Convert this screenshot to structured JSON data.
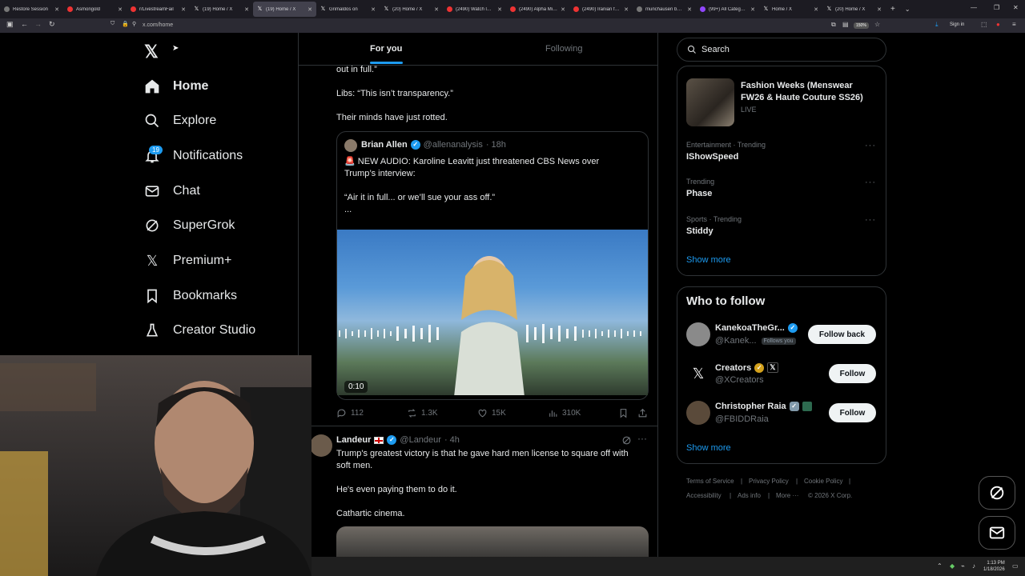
{
  "browser": {
    "tabs": [
      {
        "title": "Restore Session",
        "active": false
      },
      {
        "title": "Asmongold",
        "active": false
      },
      {
        "title": "r/LivestreamFail",
        "active": false
      },
      {
        "title": "(19) Home / X",
        "active": false
      },
      {
        "title": "(19) Home / X",
        "active": true
      },
      {
        "title": "Grimaldos on",
        "active": false
      },
      {
        "title": "(20) Home / X",
        "active": false
      },
      {
        "title": "(2490) Watch later",
        "active": false
      },
      {
        "title": "(2490) Alpha Mike",
        "active": false
      },
      {
        "title": "(2490) Iranian forc",
        "active": false
      },
      {
        "title": "munchausen by pr",
        "active": false
      },
      {
        "title": "(99+) All Categorie",
        "active": false
      },
      {
        "title": "Home / X",
        "active": false
      },
      {
        "title": "(20) Home / X",
        "active": false
      }
    ],
    "url": "x.com/home",
    "zoom": "150%",
    "sign_in": "Sign in"
  },
  "nav": {
    "items": [
      {
        "label": "Home",
        "icon": "home-icon"
      },
      {
        "label": "Explore",
        "icon": "search-icon"
      },
      {
        "label": "Notifications",
        "icon": "bell-icon"
      },
      {
        "label": "Chat",
        "icon": "mail-icon"
      },
      {
        "label": "SuperGrok",
        "icon": "grok-icon"
      },
      {
        "label": "Premium+",
        "icon": "x-logo-icon"
      },
      {
        "label": "Bookmarks",
        "icon": "bookmark-icon"
      },
      {
        "label": "Creator Studio",
        "icon": "creator-icon"
      }
    ],
    "notifications_badge": "19"
  },
  "feed": {
    "tabs": [
      "For you",
      "Following"
    ],
    "post1": {
      "lines": [
        "out in full.”",
        "Libs: “This isn’t transparency.”",
        "Their minds have just rotted."
      ]
    },
    "quote": {
      "name": "Brian Allen",
      "handle": "@allenanalysis",
      "time": "· 18h",
      "text1": "🚨 NEW AUDIO: Karoline Leavitt just threatened CBS News over",
      "text2": "Trump’s interview:",
      "text3": "“Air it in full... or we’ll sue your ass off.”",
      "text4": "...",
      "duration": "0:10"
    },
    "metrics": {
      "replies": "112",
      "reposts": "1.3K",
      "likes": "15K",
      "views": "310K"
    },
    "post2": {
      "name": "Landeur",
      "handle": "@Landeur",
      "time": "· 4h",
      "text1": "Trump's greatest victory is that he gave hard men license to square off with",
      "text2": "soft men.",
      "text3": "He's even paying them to do it.",
      "text4": "Cathartic cinema."
    }
  },
  "right": {
    "search_placeholder": "Search",
    "trends": [
      {
        "meta": "",
        "title": "Fashion Weeks (Menswear",
        "title2": "FW26 & Haute Couture SS26)",
        "sub": "LIVE"
      },
      {
        "meta": "Entertainment · Trending",
        "title": "IShowSpeed"
      },
      {
        "meta": "Trending",
        "title": "Phase"
      },
      {
        "meta": "Sports · Trending",
        "title": "Stiddy"
      }
    ],
    "show_more": "Show more",
    "who_to_follow": "Who to follow",
    "follows": [
      {
        "name": "KanekoaTheGr...",
        "handle": "@Kanek...",
        "follows_you": "Follows you",
        "button": "Follow back"
      },
      {
        "name": "Creators",
        "handle": "@XCreators",
        "button": "Follow"
      },
      {
        "name": "Christopher Raia",
        "handle": "@FBIDDRaia",
        "button": "Follow"
      }
    ],
    "show_more2": "Show more",
    "footer": [
      "Terms of Service",
      "|",
      "Privacy Policy",
      "|",
      "Cookie Policy",
      "|",
      "Accessibility",
      "|",
      "Ads info",
      "|",
      "More ···",
      "© 2026 X Corp."
    ]
  },
  "taskbar": {
    "time": "1:13 PM",
    "date": "1/18/2026"
  },
  "colors": {
    "accent": "#1d9bf0",
    "bg": "#000000",
    "border": "#2f3336",
    "muted": "#71767b"
  }
}
